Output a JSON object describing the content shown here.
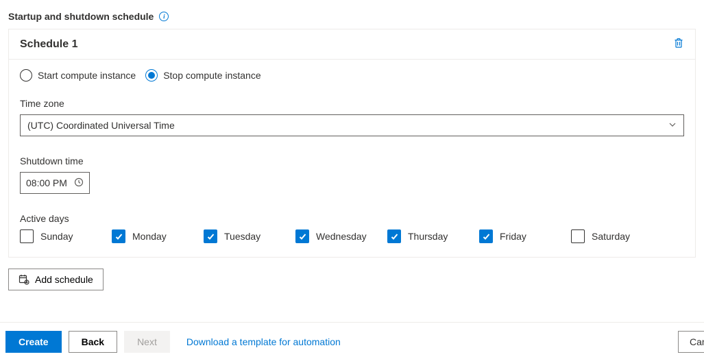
{
  "section_title": "Startup and shutdown schedule",
  "card": {
    "title": "Schedule 1",
    "radios": {
      "start_label": "Start compute instance",
      "stop_label": "Stop compute instance",
      "selected": "stop"
    },
    "timezone": {
      "label": "Time zone",
      "value": "(UTC) Coordinated Universal Time"
    },
    "shutdown": {
      "label": "Shutdown time",
      "value": "08:00 PM"
    },
    "active_days": {
      "label": "Active days",
      "days": [
        {
          "label": "Sunday",
          "checked": false
        },
        {
          "label": "Monday",
          "checked": true
        },
        {
          "label": "Tuesday",
          "checked": true
        },
        {
          "label": "Wednesday",
          "checked": true
        },
        {
          "label": "Thursday",
          "checked": true
        },
        {
          "label": "Friday",
          "checked": true
        },
        {
          "label": "Saturday",
          "checked": false
        }
      ]
    }
  },
  "add_schedule_label": "Add schedule",
  "footer": {
    "create": "Create",
    "back": "Back",
    "next": "Next",
    "download_link": "Download a template for automation",
    "cancel": "Cancel"
  }
}
